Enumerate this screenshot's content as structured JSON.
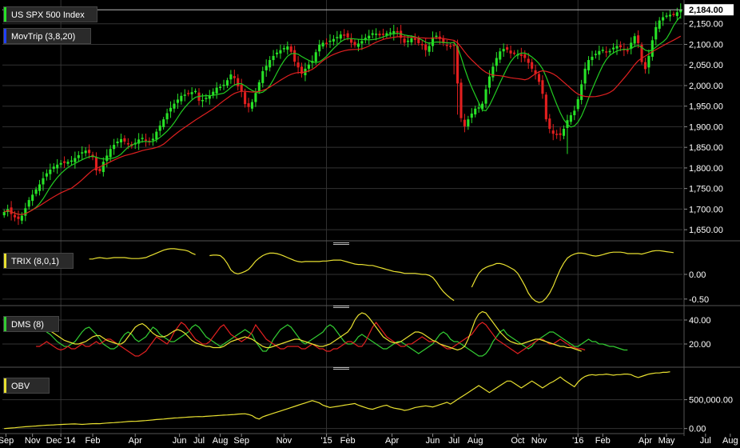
{
  "colors": {
    "background": "#000000",
    "grid": "#333333",
    "axis_text": "#ffffff",
    "up_candle": "#27e227",
    "down_candle": "#e21f1f",
    "mov_fast": "#22cc22",
    "mov_slow": "#e02020",
    "trix": "#e8e030",
    "dms_plus": "#33cc33",
    "dms_minus": "#e02020",
    "dms_adx": "#e8e030",
    "obv": "#e8e030",
    "last_price_bg": "#ffffff"
  },
  "chart_data": [
    {
      "type": "candlestick",
      "legend": [
        {
          "label": "US SPX 500 Index",
          "color": "#27e227"
        },
        {
          "label": "MovTrip (3,8,20)",
          "color": "#2040ff"
        }
      ],
      "last_price_label": "2,184.00",
      "last_price": 2184,
      "y_ticks": [
        1650,
        1700,
        1750,
        1800,
        1850,
        1900,
        1950,
        2000,
        2050,
        2100,
        2150
      ],
      "y_tick_labels": [
        "1,650.00",
        "1,700.00",
        "1,750.00",
        "1,800.00",
        "1,850.00",
        "1,900.00",
        "1,950.00",
        "2,000.00",
        "2,050.00",
        "2,100.00",
        "2,150.00"
      ],
      "ylim": [
        1625,
        2200
      ],
      "x_tick_labels": [
        "Sep",
        "Nov",
        "Dec '14",
        "Feb",
        "Apr",
        "Jun",
        "Jul",
        "Aug",
        "Sep",
        "Nov",
        "'15",
        "Feb",
        "Apr",
        "Jun",
        "Jul",
        "Aug",
        "Oct",
        "Nov",
        "'16",
        "Feb",
        "Apr",
        "May",
        "Jul",
        "Aug"
      ],
      "x_ticks": [
        0.5,
        8,
        16,
        25,
        37,
        49.5,
        55,
        61,
        67,
        79,
        91,
        97,
        109.5,
        121,
        127,
        133,
        145,
        151,
        162,
        169,
        181,
        187,
        198,
        205
      ],
      "x_major_ticks": [
        16,
        91,
        162
      ],
      "close": [
        1693,
        1700,
        1688,
        1680,
        1676,
        1684,
        1702,
        1722,
        1735,
        1748,
        1760,
        1775,
        1787,
        1796,
        1803,
        1808,
        1812,
        1812,
        1815,
        1818,
        1824,
        1831,
        1838,
        1842,
        1836,
        1826,
        1794,
        1792,
        1815,
        1830,
        1846,
        1856,
        1864,
        1870,
        1864,
        1858,
        1853,
        1861,
        1869,
        1873,
        1866,
        1863,
        1871,
        1888,
        1903,
        1918,
        1933,
        1946,
        1956,
        1966,
        1975,
        1978,
        1981,
        1984,
        1987,
        1963,
        1965,
        1970,
        1975,
        1985,
        1995,
        1997,
        2002,
        2013,
        2027,
        2018,
        1998,
        1986,
        1955,
        1948,
        1960,
        1982,
        2008,
        2035,
        2048,
        2062,
        2072,
        2080,
        2086,
        2091,
        2095,
        2082,
        2058,
        2044,
        2029,
        2041,
        2051,
        2060,
        2081,
        2099,
        2104,
        2103,
        2109,
        2113,
        2118,
        2124,
        2123,
        2117,
        2104,
        2098,
        2102,
        2108,
        2116,
        2121,
        2127,
        2126,
        2122,
        2124,
        2127,
        2129,
        2132,
        2129,
        2116,
        2104,
        2109,
        2115,
        2111,
        2103,
        2098,
        2086,
        2096,
        2117,
        2121,
        2113,
        2103,
        2097,
        2095,
        2098,
        2005,
        1921,
        1901,
        1918,
        1932,
        1944,
        1947,
        1956,
        1991,
        2022,
        2046,
        2067,
        2083,
        2089,
        2087,
        2078,
        2079,
        2076,
        2072,
        2067,
        2055,
        2041,
        2028,
        2009,
        1980,
        1918,
        1895,
        1883,
        1880,
        1880,
        1895,
        1916,
        1928,
        1939,
        1967,
        2003,
        2041,
        2062,
        2070,
        2077,
        2084,
        2087,
        2081,
        2084,
        2092,
        2096,
        2093,
        2086,
        2085,
        2104,
        2120,
        2103,
        2057,
        2040,
        2072,
        2110,
        2142,
        2158,
        2166,
        2170,
        2172,
        2173,
        2178,
        2184
      ]
    },
    {
      "type": "line",
      "name": "TRIX (8,0,1)",
      "color": "#e8e030",
      "y_ticks": [
        0,
        -0.5
      ],
      "y_tick_labels": [
        "0.00",
        "-0.50"
      ],
      "ylim": [
        -0.6,
        0.55
      ],
      "start_index": 24,
      "gaps": [
        [
          55,
          57
        ],
        [
          128,
          131
        ]
      ],
      "values": [
        0.31,
        0.31,
        0.33,
        0.34,
        0.33,
        0.32,
        0.33,
        0.34,
        0.34,
        0.34,
        0.34,
        0.33,
        0.32,
        0.32,
        0.32,
        0.33,
        0.34,
        0.37,
        0.4,
        0.43,
        0.46,
        0.49,
        0.51,
        0.52,
        0.52,
        0.51,
        0.5,
        0.49,
        0.47,
        0.43,
        0.4,
        0.38,
        0.37,
        0.37,
        0.38,
        0.39,
        0.39,
        0.38,
        0.32,
        0.22,
        0.09,
        0.03,
        0.01,
        0.03,
        0.06,
        0.1,
        0.18,
        0.27,
        0.33,
        0.38,
        0.41,
        0.43,
        0.43,
        0.42,
        0.4,
        0.37,
        0.34,
        0.31,
        0.28,
        0.26,
        0.25,
        0.26,
        0.26,
        0.26,
        0.26,
        0.26,
        0.27,
        0.27,
        0.28,
        0.29,
        0.29,
        0.29,
        0.27,
        0.25,
        0.23,
        0.21,
        0.2,
        0.2,
        0.19,
        0.18,
        0.18,
        0.16,
        0.14,
        0.12,
        0.1,
        0.08,
        0.06,
        0.05,
        0.04,
        0.02,
        0.02,
        0.02,
        0.02,
        0.01,
        0.0,
        0.0,
        -0.02,
        -0.06,
        -0.15,
        -0.26,
        -0.35,
        -0.42,
        -0.48,
        -0.53,
        -0.55,
        -0.54,
        -0.49,
        -0.39,
        -0.26,
        -0.11,
        0.02,
        0.1,
        0.14,
        0.17,
        0.19,
        0.22,
        0.22,
        0.2,
        0.17,
        0.13,
        0.09,
        0.02,
        -0.1,
        -0.23,
        -0.38,
        -0.48,
        -0.54,
        -0.57,
        -0.55,
        -0.48,
        -0.38,
        -0.24,
        -0.06,
        0.1,
        0.23,
        0.33,
        0.38,
        0.41,
        0.43,
        0.43,
        0.42,
        0.4,
        0.38,
        0.37,
        0.38,
        0.4,
        0.42,
        0.44,
        0.45,
        0.45,
        0.45,
        0.44,
        0.42,
        0.42,
        0.42,
        0.42,
        0.41,
        0.43,
        0.45,
        0.47,
        0.48,
        0.48,
        0.47,
        0.46,
        0.45,
        0.44
      ]
    },
    {
      "type": "line",
      "name": "DMS (8)",
      "y_ticks": [
        40,
        20
      ],
      "y_tick_labels": [
        "40.00",
        "20.00"
      ],
      "ylim": [
        2,
        48
      ],
      "start_index": 9,
      "series": [
        {
          "color": "#33cc33",
          "values": [
            38,
            36,
            34,
            30,
            28,
            25,
            22,
            20,
            18,
            18,
            20,
            22,
            26,
            30,
            33,
            34,
            31,
            28,
            24,
            20,
            18,
            16,
            16,
            18,
            24,
            28,
            30,
            28,
            24,
            22,
            24,
            26,
            30,
            34,
            32,
            28,
            26,
            24,
            22,
            22,
            24,
            26,
            28,
            30,
            34,
            36,
            34,
            30,
            26,
            24,
            22,
            20,
            18,
            20,
            22,
            24,
            26,
            28,
            30,
            32,
            30,
            28,
            22,
            18,
            14,
            14,
            18,
            24,
            28,
            32,
            34,
            36,
            34,
            30,
            26,
            22,
            20,
            22,
            24,
            26,
            28,
            30,
            34,
            36,
            34,
            30,
            26,
            22,
            20,
            20,
            22,
            26,
            28,
            26,
            24,
            22,
            20,
            18,
            16,
            16,
            18,
            20,
            22,
            22,
            20,
            18,
            16,
            14,
            12,
            14,
            16,
            18,
            20,
            24,
            28,
            30,
            28,
            24,
            22,
            22,
            20,
            18,
            16,
            14,
            12,
            10,
            10,
            12,
            16,
            22,
            26,
            30,
            32,
            28,
            26,
            24,
            22,
            20,
            18,
            16,
            18,
            22,
            24,
            26,
            28,
            30,
            30,
            28,
            26,
            24,
            22,
            20,
            18,
            18,
            20,
            22,
            24,
            22,
            22,
            20,
            20,
            19,
            18,
            18,
            17,
            16,
            15,
            15
          ]
        },
        {
          "color": "#e02020",
          "values": [
            18,
            18,
            20,
            22,
            20,
            18,
            16,
            15,
            16,
            18,
            16,
            16,
            18,
            20,
            18,
            18,
            20,
            22,
            20,
            22,
            24,
            24,
            22,
            20,
            18,
            16,
            14,
            12,
            10,
            10,
            12,
            14,
            18,
            22,
            26,
            24,
            22,
            20,
            24,
            30,
            34,
            38,
            36,
            32,
            28,
            24,
            22,
            20,
            20,
            22,
            26,
            30,
            34,
            36,
            32,
            28,
            26,
            24,
            22,
            24,
            26,
            30,
            36,
            32,
            28,
            24,
            22,
            20,
            18,
            16,
            16,
            18,
            18,
            18,
            18,
            16,
            16,
            18,
            20,
            18,
            16,
            16,
            14,
            14,
            16,
            16,
            18,
            20,
            22,
            22,
            20,
            18,
            18,
            22,
            28,
            34,
            38,
            34,
            30,
            26,
            24,
            22,
            20,
            18,
            18,
            20,
            20,
            22,
            24,
            26,
            24,
            22,
            22,
            22,
            20,
            18,
            16,
            16,
            18,
            20,
            22,
            24,
            26,
            28,
            32,
            36,
            38,
            36,
            32,
            28,
            24,
            22,
            20,
            18,
            16,
            14,
            12,
            14,
            16,
            18,
            20,
            22,
            24,
            24,
            22,
            20,
            20,
            22,
            24,
            22,
            20,
            18,
            17,
            16,
            16,
            15
          ]
        },
        {
          "color": "#e8e030",
          "values": [
            36,
            35,
            34,
            33,
            31,
            29,
            27,
            25,
            23,
            22,
            21,
            20,
            20,
            21,
            22,
            24,
            26,
            27,
            27,
            25,
            23,
            22,
            21,
            20,
            20,
            22,
            26,
            30,
            34,
            36,
            37,
            35,
            32,
            29,
            27,
            26,
            26,
            27,
            29,
            31,
            32,
            31,
            29,
            26,
            23,
            21,
            20,
            19,
            18,
            18,
            17,
            17,
            17,
            18,
            20,
            22,
            23,
            24,
            25,
            26,
            25,
            24,
            22,
            20,
            18,
            17,
            17,
            18,
            19,
            20,
            21,
            22,
            23,
            24,
            24,
            23,
            22,
            21,
            20,
            19,
            18,
            18,
            19,
            20,
            22,
            24,
            26,
            28,
            30,
            34,
            40,
            44,
            46,
            45,
            42,
            38,
            34,
            30,
            26,
            24,
            22,
            21,
            21,
            22,
            24,
            26,
            28,
            30,
            30,
            29,
            27,
            25,
            23,
            22,
            20,
            19,
            18,
            17,
            16,
            15,
            16,
            18,
            24,
            32,
            40,
            45,
            47,
            46,
            42,
            38,
            34,
            30,
            27,
            24,
            22,
            21,
            20,
            20,
            21,
            22,
            23,
            24,
            24,
            23,
            22,
            21,
            20,
            19,
            18,
            18,
            17,
            17,
            16,
            15,
            14
          ]
        }
      ]
    },
    {
      "type": "line",
      "name": "OBV",
      "color": "#e8e030",
      "y_ticks": [
        500000,
        0
      ],
      "y_tick_labels": [
        "500,000.00",
        "0.00"
      ],
      "ylim": [
        -60000,
        980000
      ],
      "start_index": 0,
      "values": [
        0,
        4000,
        9000,
        14000,
        20000,
        26000,
        32000,
        36000,
        40000,
        44000,
        49000,
        54000,
        58000,
        61000,
        64000,
        67000,
        70000,
        73000,
        76000,
        78000,
        80000,
        76000,
        72000,
        76000,
        80000,
        84000,
        86000,
        84000,
        90000,
        96000,
        100000,
        102000,
        106000,
        110000,
        116000,
        122000,
        126000,
        124000,
        128000,
        134000,
        138000,
        144000,
        150000,
        156000,
        160000,
        164000,
        170000,
        176000,
        182000,
        186000,
        190000,
        194000,
        198000,
        202000,
        206000,
        208000,
        206000,
        212000,
        216000,
        220000,
        224000,
        228000,
        232000,
        236000,
        240000,
        244000,
        250000,
        254000,
        256000,
        244000,
        224000,
        184000,
        164000,
        204000,
        224000,
        244000,
        264000,
        284000,
        304000,
        324000,
        344000,
        364000,
        384000,
        404000,
        424000,
        444000,
        464000,
        484000,
        464000,
        444000,
        404000,
        384000,
        364000,
        374000,
        384000,
        394000,
        404000,
        414000,
        424000,
        434000,
        404000,
        384000,
        364000,
        344000,
        334000,
        354000,
        374000,
        394000,
        404000,
        374000,
        354000,
        344000,
        334000,
        314000,
        324000,
        344000,
        364000,
        374000,
        384000,
        394000,
        384000,
        374000,
        394000,
        414000,
        434000,
        454000,
        424000,
        464000,
        504000,
        544000,
        584000,
        624000,
        664000,
        704000,
        744000,
        704000,
        664000,
        624000,
        664000,
        704000,
        744000,
        784000,
        824000,
        824000,
        784000,
        744000,
        704000,
        744000,
        784000,
        824000,
        784000,
        744000,
        704000,
        744000,
        784000,
        814000,
        854000,
        894000,
        844000,
        804000,
        764000,
        724000,
        804000,
        864000,
        904000,
        924000,
        934000,
        924000,
        934000,
        934000,
        944000,
        934000,
        924000,
        934000,
        934000,
        944000,
        944000,
        934000,
        904000,
        884000,
        904000,
        924000,
        944000,
        954000,
        964000,
        964000,
        974000,
        974000,
        984000
      ]
    }
  ],
  "legends": {
    "trix": {
      "label": "TRIX (8,0,1)",
      "color": "#e8e030"
    },
    "dms": {
      "label": "DMS (8)",
      "color": "#33cc33"
    },
    "obv": {
      "label": "OBV",
      "color": "#e8e030"
    }
  }
}
